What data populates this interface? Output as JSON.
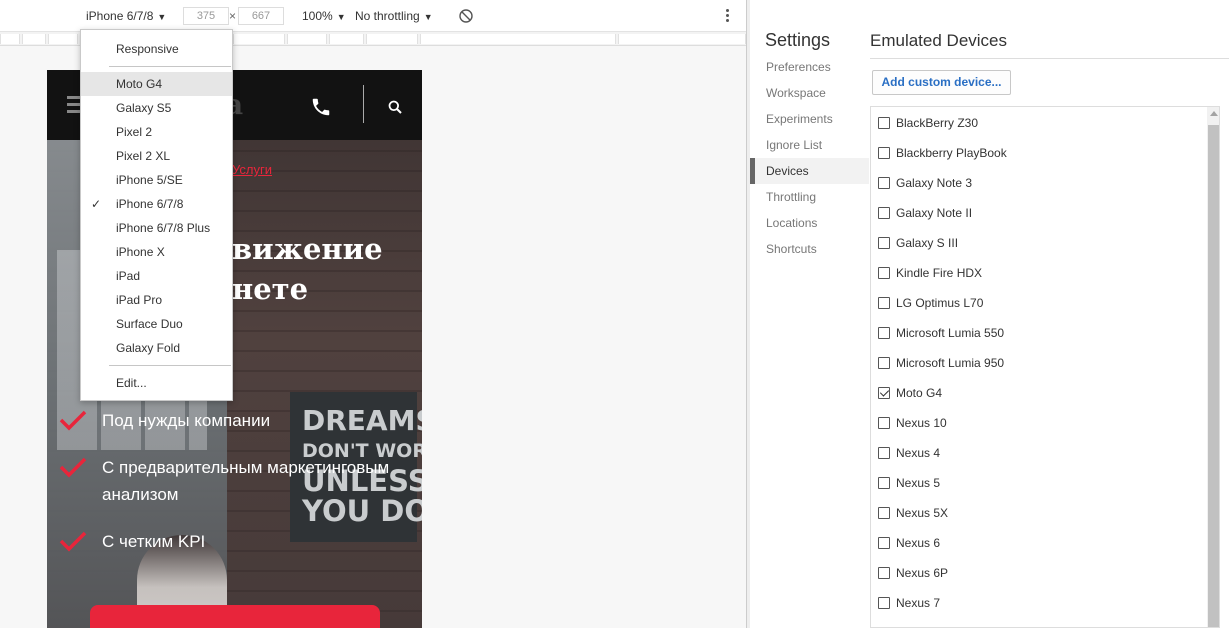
{
  "toolbar": {
    "device_select": "iPhone 6/7/8",
    "width_value": "375",
    "times": "×",
    "height_value": "667",
    "zoom": "100%",
    "throttling": "No throttling"
  },
  "device_menu": {
    "responsive": "Responsive",
    "items": [
      "Moto G4",
      "Galaxy S5",
      "Pixel 2",
      "Pixel 2 XL",
      "iPhone 5/SE",
      "iPhone 6/7/8",
      "iPhone 6/7/8 Plus",
      "iPhone X",
      "iPad",
      "iPad Pro",
      "Surface Duo",
      "Galaxy Fold"
    ],
    "highlighted": "Moto G4",
    "checked": "iPhone 6/7/8",
    "edit": "Edit..."
  },
  "phone_page": {
    "logo_fragment": "a",
    "breadcrumb": "Услуги",
    "title_line1": "вижение",
    "title_line2": "нете",
    "poster_lines": [
      "DREAMS",
      "DON'T WORK",
      "UNLESS",
      "YOU DO"
    ],
    "checklist": [
      "Под нужды компании",
      "С предварительным маркетинговым анализом",
      "С четким KPI"
    ],
    "accent": "#e8253b"
  },
  "settings": {
    "title": "Settings",
    "nav": [
      "Preferences",
      "Workspace",
      "Experiments",
      "Ignore List",
      "Devices",
      "Throttling",
      "Locations",
      "Shortcuts"
    ],
    "active_nav": "Devices",
    "content_title": "Emulated Devices",
    "add_button": "Add custom device...",
    "devices": [
      {
        "name": "BlackBerry Z30",
        "checked": false
      },
      {
        "name": "Blackberry PlayBook",
        "checked": false
      },
      {
        "name": "Galaxy Note 3",
        "checked": false
      },
      {
        "name": "Galaxy Note II",
        "checked": false
      },
      {
        "name": "Galaxy S III",
        "checked": false
      },
      {
        "name": "Kindle Fire HDX",
        "checked": false
      },
      {
        "name": "LG Optimus L70",
        "checked": false
      },
      {
        "name": "Microsoft Lumia 550",
        "checked": false
      },
      {
        "name": "Microsoft Lumia 950",
        "checked": false
      },
      {
        "name": "Moto G4",
        "checked": true
      },
      {
        "name": "Nexus 10",
        "checked": false
      },
      {
        "name": "Nexus 4",
        "checked": false
      },
      {
        "name": "Nexus 5",
        "checked": false
      },
      {
        "name": "Nexus 5X",
        "checked": false
      },
      {
        "name": "Nexus 6",
        "checked": false
      },
      {
        "name": "Nexus 6P",
        "checked": false
      },
      {
        "name": "Nexus 7",
        "checked": false
      }
    ],
    "link_color": "#2a6fc4"
  }
}
